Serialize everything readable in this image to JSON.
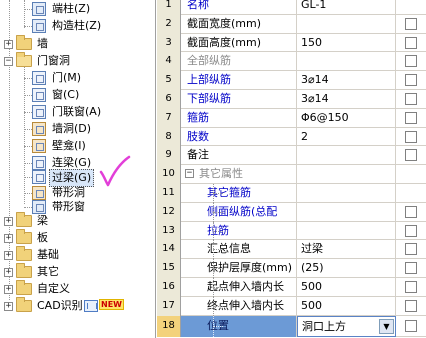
{
  "tree": {
    "items": [
      {
        "label": "端柱(Z)",
        "icon": "end-column-icon"
      },
      {
        "label": "构造柱(Z)",
        "icon": "structural-column-icon"
      },
      {
        "label": "墙",
        "icon": "folder-icon"
      },
      {
        "label": "门窗洞",
        "icon": "folder-open-icon"
      },
      {
        "label": "门(M)",
        "icon": "door-icon"
      },
      {
        "label": "窗(C)",
        "icon": "window-icon"
      },
      {
        "label": "门联窗(A)",
        "icon": "door-window-icon"
      },
      {
        "label": "墙洞(D)",
        "icon": "wall-hole-icon"
      },
      {
        "label": "壁龛(I)",
        "icon": "niche-icon"
      },
      {
        "label": "连梁(G)",
        "icon": "coupling-beam-icon"
      },
      {
        "label": "过梁(G)",
        "icon": "lintel-icon"
      },
      {
        "label": "带形洞",
        "icon": "strip-hole-icon"
      },
      {
        "label": "带形窗",
        "icon": "strip-window-icon"
      },
      {
        "label": "梁",
        "icon": "folder-icon"
      },
      {
        "label": "板",
        "icon": "folder-icon"
      },
      {
        "label": "基础",
        "icon": "folder-icon"
      },
      {
        "label": "其它",
        "icon": "folder-icon"
      },
      {
        "label": "自定义",
        "icon": "folder-icon"
      },
      {
        "label": "CAD识别",
        "icon": "folder-icon"
      }
    ],
    "new_badge": "NEW",
    "selected_index": 10
  },
  "grid": {
    "rows": [
      {
        "num": "1",
        "name": "名称",
        "value": "GL-1",
        "style": "blue",
        "checkbox": false
      },
      {
        "num": "2",
        "name": "截面宽度(mm)",
        "value": "",
        "style": "normal",
        "checkbox": true
      },
      {
        "num": "3",
        "name": "截面高度(mm)",
        "value": "150",
        "style": "normal",
        "checkbox": true
      },
      {
        "num": "4",
        "name": "全部纵筋",
        "value": "",
        "style": "gray",
        "checkbox": true
      },
      {
        "num": "5",
        "name": "上部纵筋",
        "value": "3⌀14",
        "style": "blue",
        "checkbox": true
      },
      {
        "num": "6",
        "name": "下部纵筋",
        "value": "3⌀14",
        "style": "blue",
        "checkbox": true
      },
      {
        "num": "7",
        "name": "箍筋",
        "value": "Φ6@150",
        "style": "blue",
        "checkbox": true
      },
      {
        "num": "8",
        "name": "肢数",
        "value": "2",
        "style": "blue",
        "checkbox": true
      },
      {
        "num": "9",
        "name": "备注",
        "value": "",
        "style": "normal",
        "checkbox": true
      },
      {
        "num": "10",
        "name": "其它属性",
        "value": "",
        "style": "group",
        "checkbox": false
      },
      {
        "num": "11",
        "name": "其它箍筋",
        "value": "",
        "style": "blue-sub",
        "checkbox": false
      },
      {
        "num": "12",
        "name": "侧面纵筋(总配",
        "value": "",
        "style": "blue-sub",
        "checkbox": true
      },
      {
        "num": "13",
        "name": "拉筋",
        "value": "",
        "style": "blue-sub",
        "checkbox": true
      },
      {
        "num": "14",
        "name": "汇总信息",
        "value": "过梁",
        "style": "sub",
        "checkbox": true
      },
      {
        "num": "15",
        "name": "保护层厚度(mm)",
        "value": "(25)",
        "style": "sub",
        "checkbox": true
      },
      {
        "num": "16",
        "name": "起点伸入墙内长",
        "value": "500",
        "style": "sub",
        "checkbox": true
      },
      {
        "num": "17",
        "name": "终点伸入墙内长",
        "value": "500",
        "style": "sub",
        "checkbox": true
      },
      {
        "num": "18",
        "name": "位置",
        "value": "洞口上方",
        "style": "sub-selected",
        "checkbox": true
      }
    ],
    "dropdown_arrow": "▼",
    "collapse_glyph": "−"
  },
  "colors": {
    "blue_text": "#0000c8",
    "selected_row_bg": "#6c9ad6",
    "annotation_pink": "#e23fd8"
  }
}
